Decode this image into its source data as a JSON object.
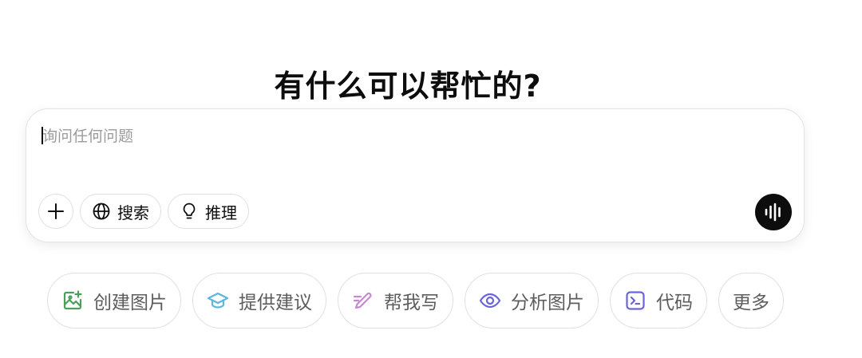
{
  "heading": "有什么可以帮忙的?",
  "composer": {
    "placeholder": "询问任何问题",
    "value": ""
  },
  "tools": {
    "add_icon": "plus-icon",
    "search": {
      "label": "搜索",
      "icon": "globe-icon"
    },
    "reason": {
      "label": "推理",
      "icon": "lightbulb-icon"
    },
    "voice_icon": "voice-waveform-icon"
  },
  "suggestions": [
    {
      "label": "创建图片",
      "icon": "image-create-icon",
      "color": "#4aa05a"
    },
    {
      "label": "提供建议",
      "icon": "graduation-cap-icon",
      "color": "#5bb8d8"
    },
    {
      "label": "帮我写",
      "icon": "pen-icon",
      "color": "#c58bcf"
    },
    {
      "label": "分析图片",
      "icon": "eye-icon",
      "color": "#6b63d9"
    },
    {
      "label": "代码",
      "icon": "terminal-icon",
      "color": "#6b63d9"
    },
    {
      "label": "更多"
    }
  ]
}
